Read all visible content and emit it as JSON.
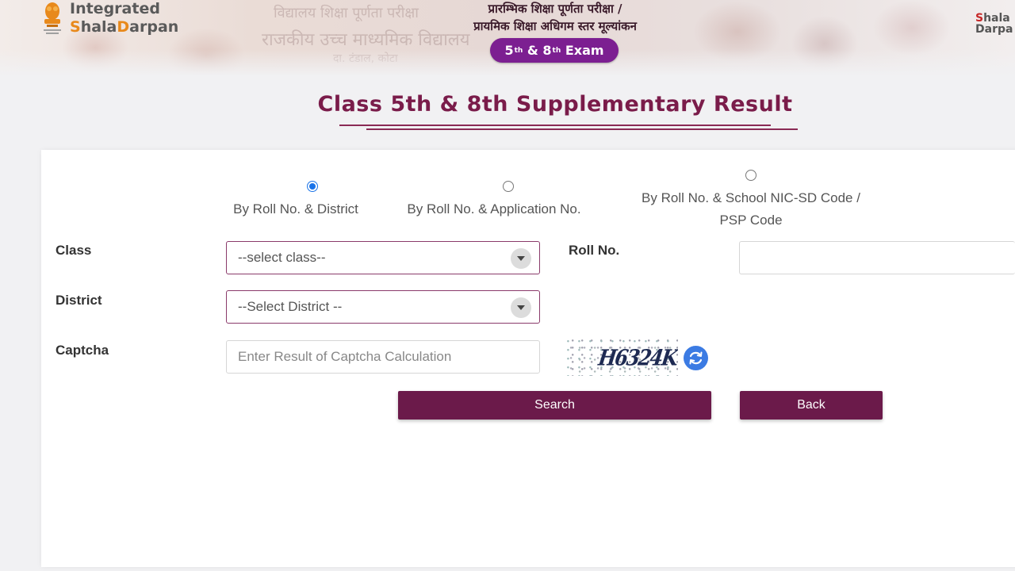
{
  "header": {
    "logo": {
      "line1": "Integrated",
      "line2_s": "S",
      "line2_hala": "hala",
      "line2_d": "D",
      "line2_arpan": "arpan"
    },
    "hindi_title_line1": "प्रारम्भिक शिक्षा पूर्णता परीक्षा /",
    "hindi_title_line2": "प्रायमिक शिक्षा अधिगम स्तर मूल्यांकन",
    "exam_badge": {
      "n1": "5",
      "s1": "th",
      "amp": " & ",
      "n2": "8",
      "s2": "th",
      "word": " Exam"
    },
    "right_logo": {
      "r": "S",
      "rest1": "hala",
      "line2": "Darpa"
    },
    "background_text": [
      "विद्यालय शिक्षा पूर्णता परीक्षा",
      "राजकीय उच्च माध्यमिक विद्यालय",
      "दा. टंडाल, कोटा"
    ]
  },
  "page_title": "Class 5th & 8th Supplementary Result",
  "search_options": [
    {
      "label": "By Roll No. & District",
      "checked": true
    },
    {
      "label": "By Roll No. & Application No.",
      "checked": false
    },
    {
      "label_line1": "By Roll No. & School NIC-SD Code /",
      "label_line2": "PSP Code",
      "checked": false
    }
  ],
  "form": {
    "class_label": "Class",
    "class_select_value": "--select class--",
    "roll_label": "Roll No.",
    "roll_value": "",
    "district_label": "District",
    "district_select_value": "--Select District --",
    "captcha_label": "Captcha",
    "captcha_placeholder": "Enter Result of Captcha Calculation",
    "captcha_text": "H6324K"
  },
  "buttons": {
    "search": "Search",
    "back": "Back"
  },
  "colors": {
    "primary": "#6b1a4a",
    "title": "#7a1c4a",
    "badge": "#7c1f91",
    "radio": "#1a73e8",
    "refresh": "#3b7be3"
  },
  "icons": {
    "emblem": "state-emblem-icon",
    "caret": "chevron-down-icon",
    "refresh": "refresh-icon"
  }
}
